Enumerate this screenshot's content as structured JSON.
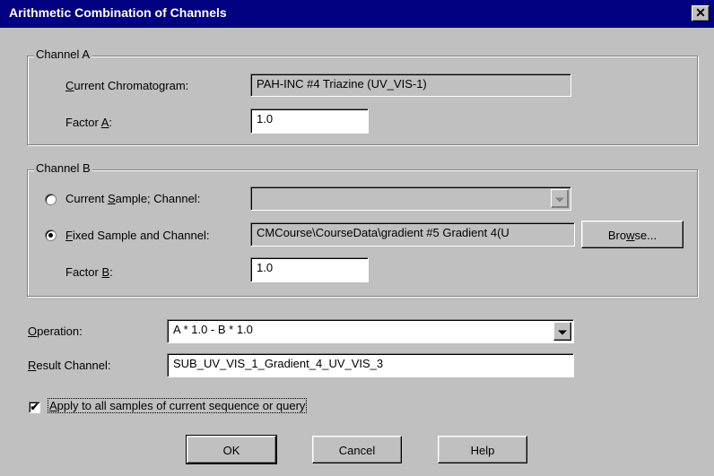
{
  "dialog": {
    "title": "Arithmetic Combination of Channels",
    "close_glyph": "✕"
  },
  "channel_a": {
    "group_title": "Channel A",
    "current_chromatogram_label": "Current Chromatogram:",
    "current_chromatogram_value": "PAH-INC #4 Triazine (UV_VIS-1)",
    "factor_label": "Factor A:",
    "factor_value": "1.0"
  },
  "channel_b": {
    "group_title": "Channel B",
    "current_sample_label": "Current Sample; Channel:",
    "current_sample_value": "",
    "current_sample_selected": false,
    "fixed_sample_label": "Fixed Sample and Channel:",
    "fixed_sample_value": "CMCourse\\CourseData\\gradient #5 Gradient 4(U",
    "fixed_sample_selected": true,
    "browse_label": "Browse...",
    "factor_label": "Factor B:",
    "factor_value": "1.0"
  },
  "operation": {
    "label": "Operation:",
    "value": "A * 1.0 - B * 1.0"
  },
  "result_channel": {
    "label": "Result Channel:",
    "value": "SUB_UV_VIS_1_Gradient_4_UV_VIS_3"
  },
  "apply_all": {
    "label": "Apply to all samples of current sequence or query",
    "checked": true
  },
  "buttons": {
    "ok": "OK",
    "cancel": "Cancel",
    "help": "Help"
  },
  "icons": {
    "checkmark": "✔"
  },
  "colors": {
    "title_bar": "#000080",
    "face": "#c0c0c0"
  }
}
